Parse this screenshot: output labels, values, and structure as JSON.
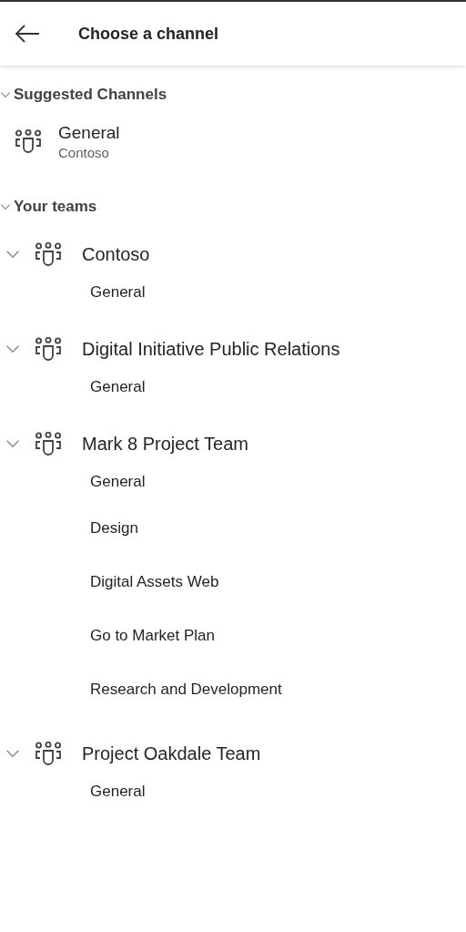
{
  "header": {
    "title": "Choose a channel"
  },
  "suggested": {
    "heading": "Suggested Channels",
    "expanded": true,
    "items": [
      {
        "name": "General",
        "team": "Contoso"
      }
    ]
  },
  "teams_section": {
    "heading": "Your teams",
    "expanded": true,
    "teams": [
      {
        "name": "Contoso",
        "expanded": true,
        "channels": [
          "General"
        ]
      },
      {
        "name": "Digital Initiative Public Relations",
        "expanded": true,
        "channels": [
          "General"
        ]
      },
      {
        "name": "Mark 8 Project Team",
        "expanded": true,
        "channels": [
          "General",
          "Design",
          "Digital Assets Web",
          "Go to Market Plan",
          "Research and Development"
        ]
      },
      {
        "name": "Project Oakdale Team",
        "expanded": true,
        "channels": [
          "General"
        ]
      }
    ]
  }
}
